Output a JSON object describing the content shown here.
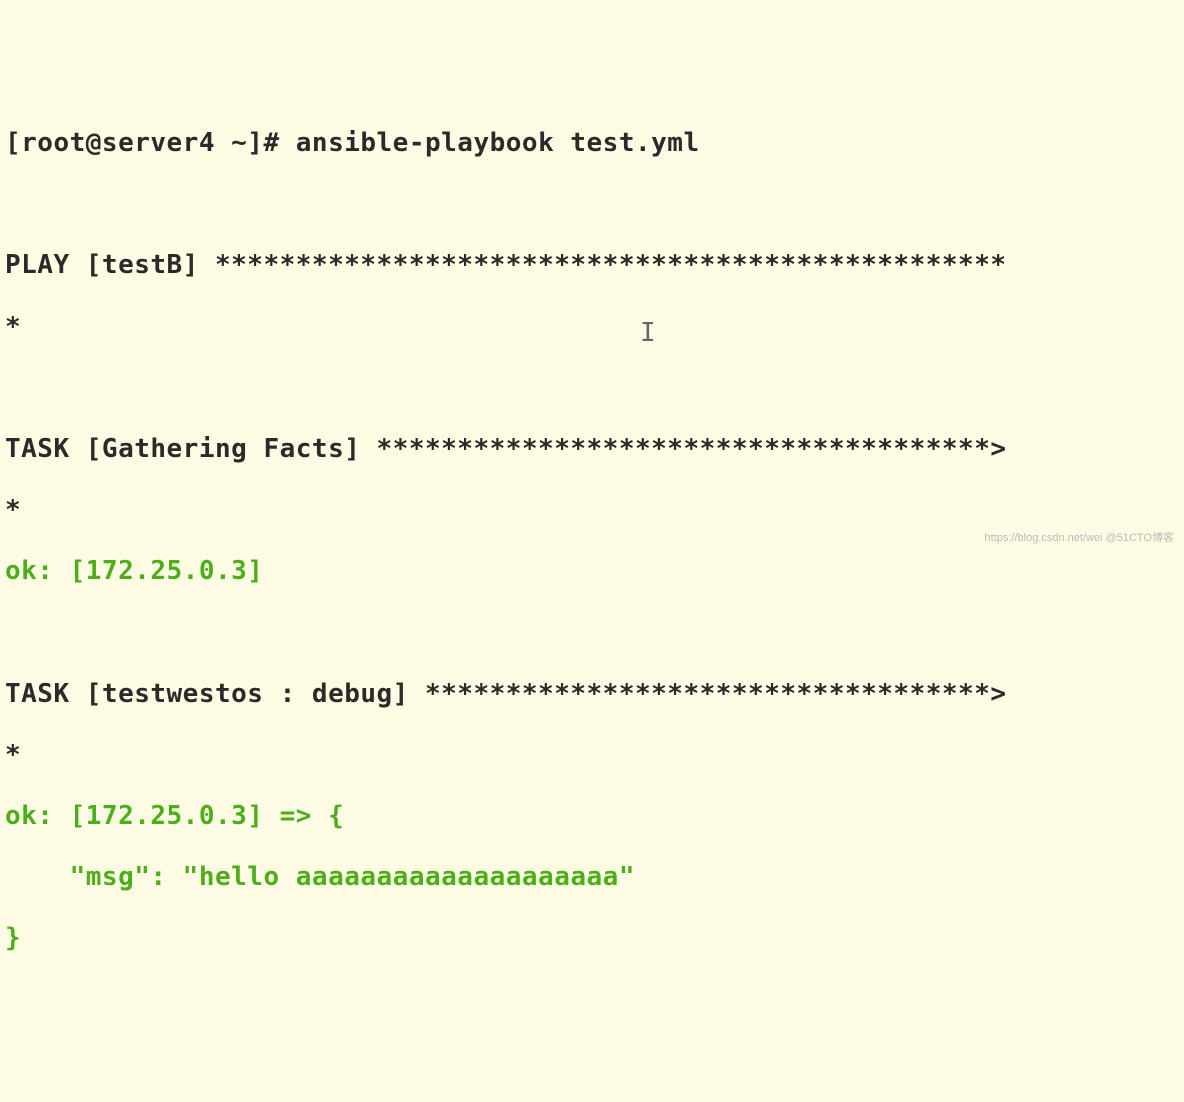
{
  "prompt": "[root@server4 ~]# ",
  "command": "ansible-playbook test.yml",
  "play_header": "PLAY [testB] *************************************************",
  "play_header_cont": "*",
  "task1_header": "TASK [Gathering Facts] **************************************>",
  "task1_header_cont": "*",
  "task1_ok": "ok: [172.25.0.3]",
  "task2_header": "TASK [testwestos : debug] ***********************************>",
  "task2_header_cont": "*",
  "task2_ok_open": "ok: [172.25.0.3] => {",
  "task2_msg": "    \"msg\": \"hello aaaaaaaaaaaaaaaaaaaa\"",
  "task2_close": "}",
  "cursor": "I",
  "watermark": "https://blog.csdn.net/wei @51CTO博客"
}
